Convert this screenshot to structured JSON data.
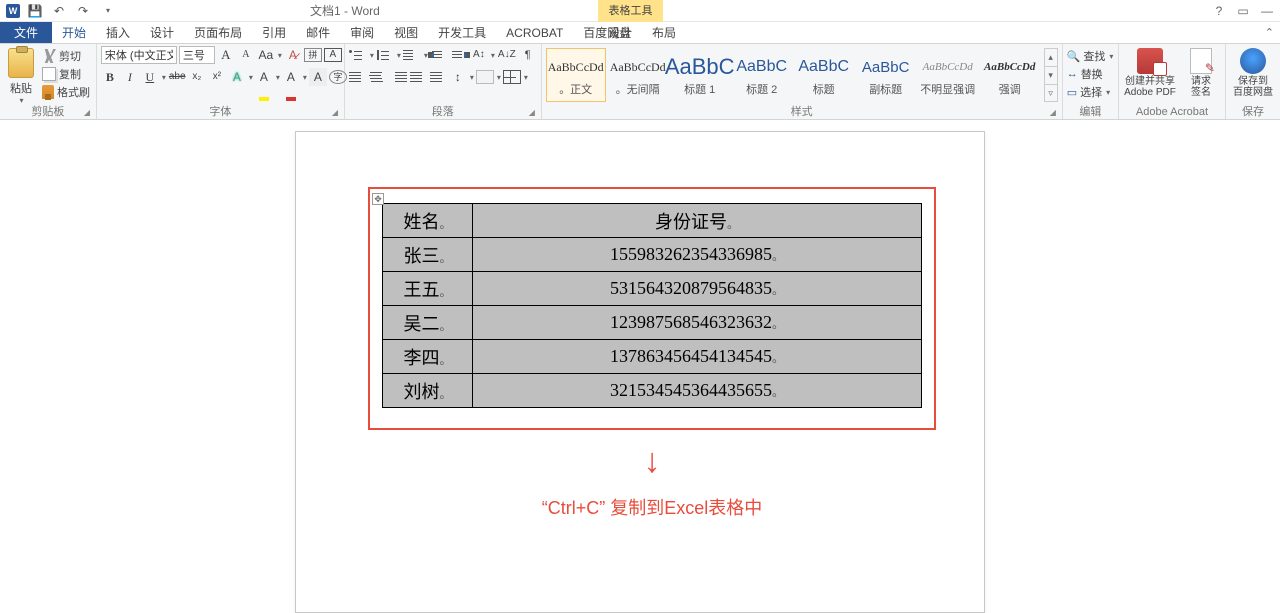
{
  "app": {
    "doc_title": "文档1 - Word",
    "context_tool": "表格工具"
  },
  "title_right": {
    "help": "?",
    "ribbon_opts": "▭",
    "min": "—"
  },
  "qat": {
    "save": "💾",
    "undo": "↶",
    "redo": "↷"
  },
  "tabs": {
    "file": "文件",
    "list": [
      "开始",
      "插入",
      "设计",
      "页面布局",
      "引用",
      "邮件",
      "审阅",
      "视图",
      "开发工具",
      "ACROBAT",
      "百度网盘"
    ],
    "active": "开始",
    "context": [
      "设计",
      "布局"
    ]
  },
  "clipboard": {
    "paste": "粘贴",
    "cut": "剪切",
    "copy": "复制",
    "format_painter": "格式刷",
    "group": "剪贴板"
  },
  "font": {
    "name": "宋体 (中文正文",
    "size": "三号",
    "grow": "A",
    "shrink": "A",
    "change_case": "Aa",
    "clear": "A",
    "phonetic": "拼",
    "char_border": "A",
    "bold": "B",
    "italic": "I",
    "underline": "U",
    "strike": "abe",
    "sub": "x₂",
    "sup": "x²",
    "texteffects": "A",
    "highlight": "A",
    "fontcolor": "A",
    "charshade": "A",
    "enclose": "字",
    "group": "字体"
  },
  "paragraph": {
    "linespacing": "↕",
    "shading": "",
    "borders": "",
    "sort": "A↓",
    "marks": "¶",
    "group": "段落",
    "azbtn": "A↕",
    "sortaz": "A↓Z"
  },
  "styles": {
    "group": "样式",
    "items": [
      {
        "prev": "AaBbCcDd",
        "name": "。正文",
        "cls": "",
        "sel": true,
        "fs": "12px"
      },
      {
        "prev": "AaBbCcDd",
        "name": "。无间隔",
        "cls": "",
        "fs": "12px"
      },
      {
        "prev": "AaBbC",
        "name": "标题 1",
        "cls": "blue",
        "fs": "22px"
      },
      {
        "prev": "AaBbC",
        "name": "标题 2",
        "cls": "blue",
        "fs": "16px"
      },
      {
        "prev": "AaBbC",
        "name": "标题",
        "cls": "blue",
        "fs": "16px"
      },
      {
        "prev": "AaBbC",
        "name": "副标题",
        "cls": "blue",
        "fs": "15px"
      },
      {
        "prev": "AaBbCcDd",
        "name": "不明显强调",
        "cls": "gray",
        "fs": "11px"
      },
      {
        "prev": "AaBbCcDd",
        "name": "强调",
        "cls": "bolditalic",
        "fs": "11px"
      }
    ]
  },
  "editing": {
    "find": "查找",
    "replace": "替换",
    "select": "选择",
    "group": "编辑"
  },
  "acrobat": {
    "create": "创建并共享\nAdobe PDF",
    "sign": "请求\n签名",
    "group": "Adobe Acrobat"
  },
  "baidu": {
    "save": "保存到\n百度网盘",
    "group": "保存"
  },
  "table": {
    "headers": {
      "name": "姓名",
      "id": "身份证号"
    },
    "rows": [
      {
        "name": "张三",
        "id": "155983262354336985"
      },
      {
        "name": "王五",
        "id": "531564320879564835"
      },
      {
        "name": "吴二",
        "id": "123987568546323632"
      },
      {
        "name": "李四",
        "id": "137863456454134545"
      },
      {
        "name": "刘树",
        "id": "321534545364435655"
      }
    ],
    "cell_mark": "。"
  },
  "annotation": {
    "arrow": "↓",
    "caption": "“Ctrl+C” 复制到Excel表格中"
  }
}
